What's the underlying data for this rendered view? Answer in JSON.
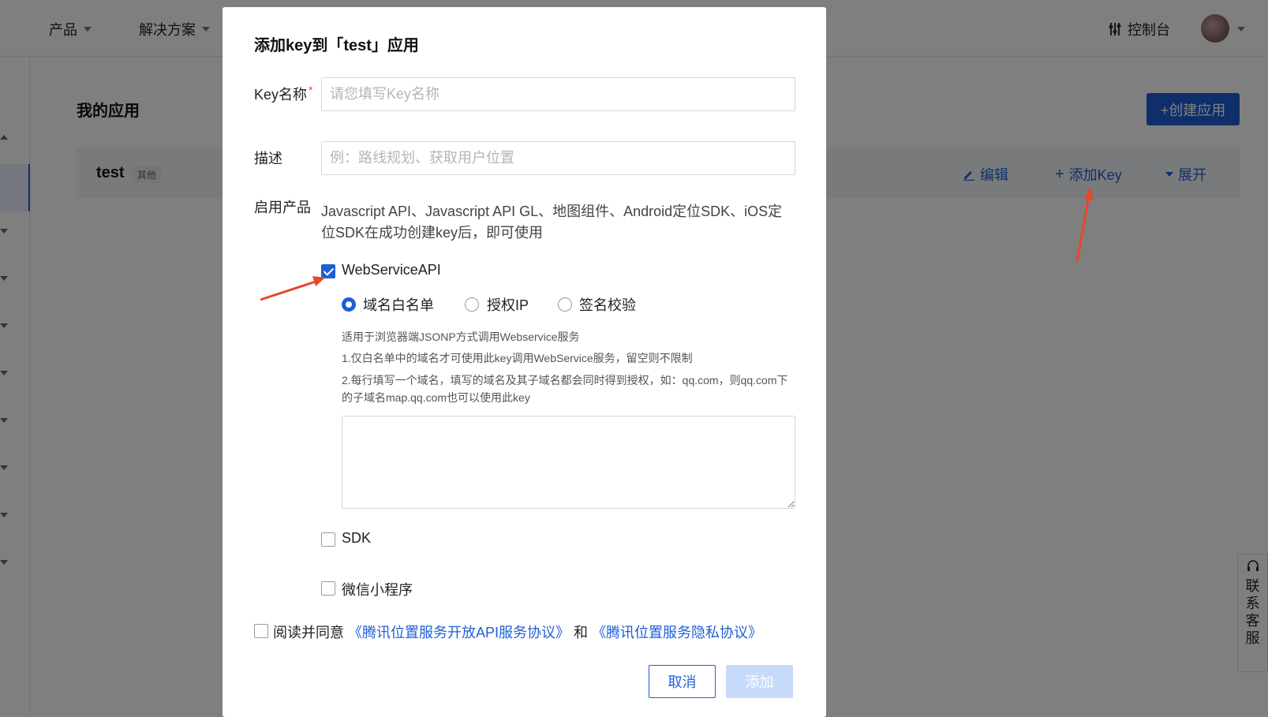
{
  "header": {
    "nav": [
      {
        "label": "产品"
      },
      {
        "label": "解决方案"
      }
    ],
    "console_label": "控制台"
  },
  "page": {
    "title": "我的应用",
    "create_button": "+创建应用",
    "app": {
      "name": "test",
      "tag": "其他",
      "actions": {
        "edit": "编辑",
        "add_key": "添加Key",
        "expand": "展开"
      }
    },
    "service_tab": "联系客服"
  },
  "modal": {
    "title": "添加key到「test」应用",
    "key_name": {
      "label": "Key名称",
      "required_mark": "*",
      "placeholder": "请您填写Key名称",
      "value": ""
    },
    "description": {
      "label": "描述",
      "placeholder": "例：路线规划、获取用户位置",
      "value": ""
    },
    "products": {
      "label": "启用产品",
      "text": "Javascript API、Javascript API GL、地图组件、Android定位SDK、iOS定位SDK在成功创建key后，即可使用"
    },
    "webservice": {
      "label": "WebServiceAPI",
      "checked": true,
      "auth_options": [
        {
          "label": "域名白名单",
          "selected": true
        },
        {
          "label": "授权IP",
          "selected": false
        },
        {
          "label": "签名校验",
          "selected": false
        }
      ],
      "hints": [
        "适用于浏览器端JSONP方式调用Webservice服务",
        "1.仅白名单中的域名才可使用此key调用WebService服务，留空则不限制",
        "2.每行填写一个域名，填写的域名及其子域名都会同时得到授权，如：qq.com，则qq.com下的子域名map.qq.com也可以使用此key"
      ],
      "whitelist_value": ""
    },
    "sdk": {
      "label": "SDK",
      "checked": false
    },
    "miniprogram": {
      "label": "微信小程序",
      "checked": false
    },
    "agreement": {
      "prefix": "阅读并同意",
      "link1": "《腾讯位置服务开放API服务协议》",
      "middle": "和",
      "link2": "《腾讯位置服务隐私协议》",
      "checked": false
    },
    "buttons": {
      "cancel": "取消",
      "add": "添加"
    }
  },
  "colors": {
    "primary": "#1f5fd6",
    "disabled_button": "#c6dafb",
    "annotation_arrow": "#e8472b",
    "overlay": "rgba(0,0,0,0.5)"
  }
}
